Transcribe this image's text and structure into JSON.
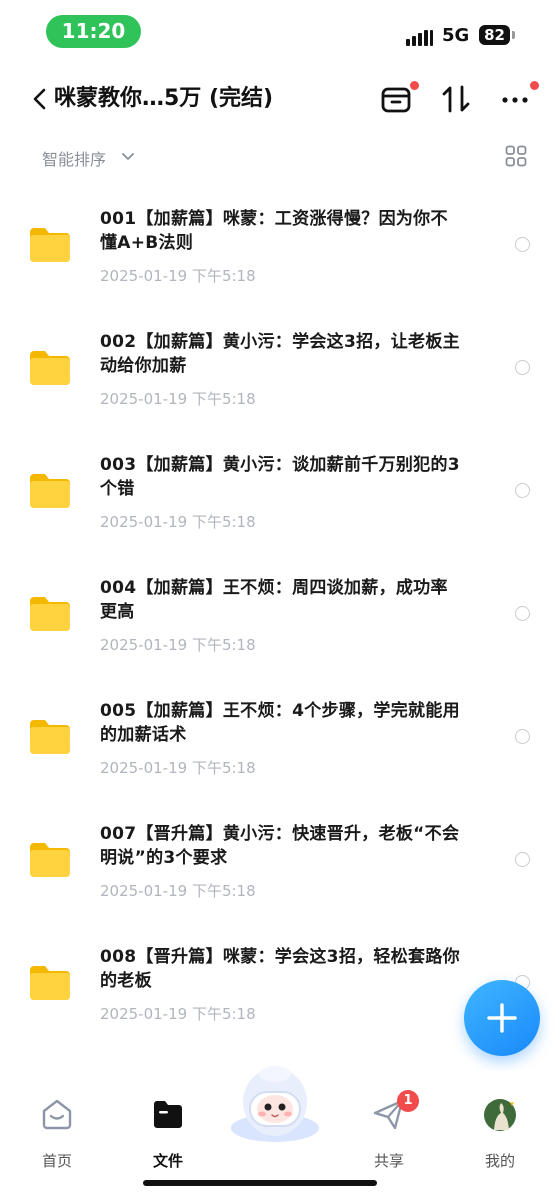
{
  "status": {
    "time": "11:20",
    "network": "5G",
    "battery": "82"
  },
  "header": {
    "title": "咪蒙教你…5万 (完结)",
    "icons": [
      "back-icon",
      "archive-icon",
      "sort-toggle-icon",
      "more-icon"
    ]
  },
  "sort": {
    "label": "智能排序",
    "icons": [
      "chevron-down-icon",
      "grid-view-icon"
    ]
  },
  "files": [
    {
      "name": "001【加薪篇】咪蒙：工资涨得慢？因为你不懂A+B法则",
      "date": "2025-01-19 下午5:18"
    },
    {
      "name": "002【加薪篇】黄小污：学会这3招，让老板主动给你加薪",
      "date": "2025-01-19 下午5:18"
    },
    {
      "name": "003【加薪篇】黄小污：谈加薪前千万别犯的3个错",
      "date": "2025-01-19 下午5:18"
    },
    {
      "name": "004【加薪篇】王不烦：周四谈加薪，成功率更高",
      "date": "2025-01-19 下午5:18"
    },
    {
      "name": "005【加薪篇】王不烦：4个步骤，学完就能用的加薪话术",
      "date": "2025-01-19 下午5:18"
    },
    {
      "name": "007【晋升篇】黄小污：快速晋升，老板“不会明说”的3个要求",
      "date": "2025-01-19 下午5:18"
    },
    {
      "name": "008【晋升篇】咪蒙：学会这3招，轻松套路你的老板",
      "date": "2025-01-19 下午5:18"
    }
  ],
  "nav": {
    "home": "首页",
    "files": "文件",
    "share": "共享",
    "share_badge": "1",
    "me": "我的"
  },
  "colors": {
    "accent": "#1989fa",
    "status_pill": "#2fc35a",
    "folder": "#ffc928",
    "badge": "#f24b4b"
  }
}
